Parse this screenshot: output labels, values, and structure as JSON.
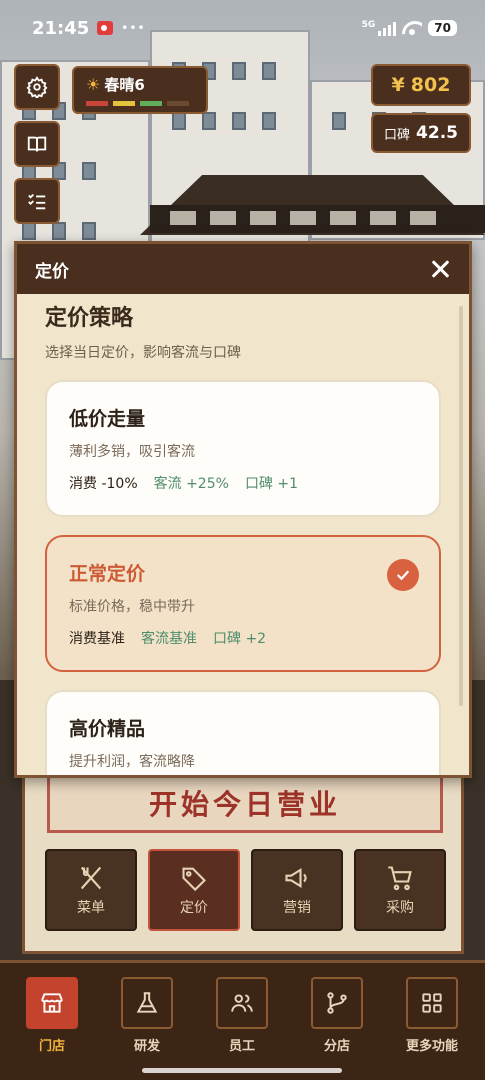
{
  "status": {
    "time": "21:45",
    "network": "5G",
    "battery": "70"
  },
  "hud": {
    "weather_label": "春晴6",
    "weather_bar_colors": [
      "#c9453a",
      "#e6c33c",
      "#5fae5a",
      "#6a4a30"
    ],
    "money_symbol": "¥",
    "money": "802",
    "reputation_label": "口碑",
    "reputation": "42.5",
    "side_buttons": [
      "gear-icon",
      "book-icon",
      "checklist-icon"
    ]
  },
  "panel": {
    "start_label": "开始今日营业",
    "actions": [
      {
        "label": "菜单",
        "icon": "utensils-icon"
      },
      {
        "label": "定价",
        "icon": "price-tag-icon",
        "active": true
      },
      {
        "label": "营销",
        "icon": "megaphone-icon"
      },
      {
        "label": "采购",
        "icon": "cart-icon"
      }
    ]
  },
  "modal": {
    "title": "定价",
    "section_title": "定价策略",
    "section_subtitle": "选择当日定价，影响客流与口碑",
    "options": [
      {
        "name": "低价走量",
        "desc": "薄利多销，吸引客流",
        "cost": "消费 -10%",
        "traffic": "客流 +25%",
        "rep": "口碑 +1",
        "selected": false
      },
      {
        "name": "正常定价",
        "desc": "标准价格，稳中带升",
        "cost": "消费基准",
        "traffic": "客流基准",
        "rep": "口碑 +2",
        "selected": true
      },
      {
        "name": "高价精品",
        "desc": "提升利润，客流略降",
        "selected": false
      }
    ]
  },
  "tabs": [
    {
      "label": "门店",
      "icon": "store-icon",
      "active": true
    },
    {
      "label": "研发",
      "icon": "flask-icon"
    },
    {
      "label": "员工",
      "icon": "users-icon"
    },
    {
      "label": "分店",
      "icon": "branch-icon"
    },
    {
      "label": "更多功能",
      "icon": "grid-icon"
    }
  ],
  "colors": {
    "accent": "#c4432d",
    "selected_border": "#d2633e",
    "positive": "#4f8c6b",
    "gold": "#f2c14e"
  }
}
